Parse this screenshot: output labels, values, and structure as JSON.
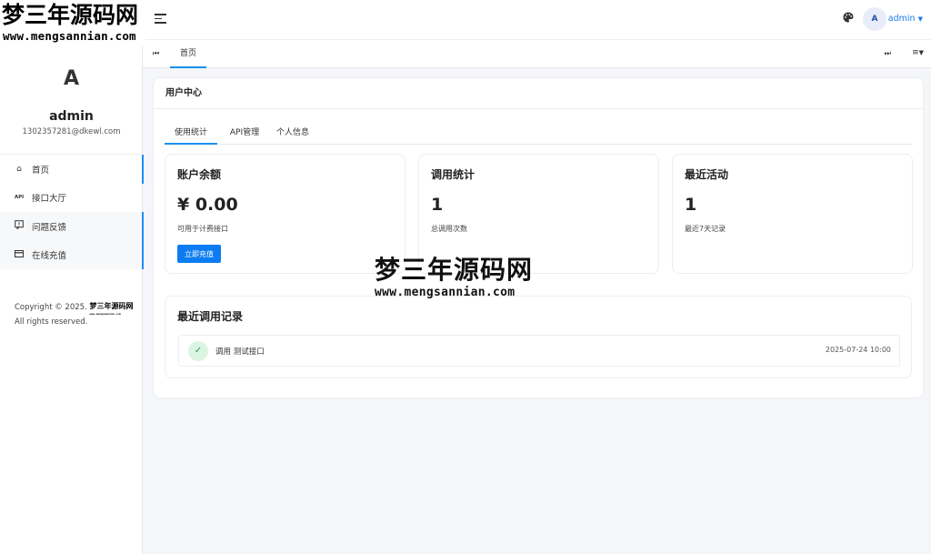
{
  "brand": {
    "name_cn": "梦三年源码网",
    "url": "www.mengsannian.com"
  },
  "profile": {
    "avatar_letter": "A",
    "name": "admin",
    "email": "1302357281@dkewl.com"
  },
  "nav": {
    "items": [
      {
        "icon": "home-icon",
        "glyph": "⌂",
        "label": "首页"
      },
      {
        "icon": "api-icon",
        "glyph": "API",
        "label": "接口大厅"
      },
      {
        "icon": "feedback-icon",
        "glyph": "☐",
        "label": "问题反馈"
      },
      {
        "icon": "card-icon",
        "glyph": "▭",
        "label": "在线充值"
      }
    ]
  },
  "footer": {
    "copyright": "Copyright © 2025.",
    "mini_brand": "梦三年源码网",
    "mini_url": "www.mengsannian.com",
    "rights": "All rights reserved."
  },
  "topbar": {
    "palette_icon": "palette-icon",
    "avatar_letter": "A",
    "user": "admin"
  },
  "tabsbar": {
    "home_tab": "首页"
  },
  "card": {
    "title": "用户中心",
    "subtabs": [
      "使用统计",
      "API管理",
      "个人信息"
    ],
    "stats": [
      {
        "title": "账户余额",
        "value": "¥ 0.00",
        "sub": "可用于计费接口",
        "button": "立即充值"
      },
      {
        "title": "调用统计",
        "value": "1",
        "sub": "总调用次数"
      },
      {
        "title": "最近活动",
        "value": "1",
        "sub": "最近7天记录"
      }
    ],
    "recent": {
      "title": "最近调用记录",
      "rows": [
        {
          "text": "调用 测试接口",
          "time": "2025-07-24 10:00"
        }
      ]
    }
  },
  "watermark": {
    "name_cn": "梦三年源码网",
    "url": "www.mengsannian.com"
  },
  "colors": {
    "accent": "#1a8ff0",
    "button": "#0d7cf2",
    "success": "#2c9a4a"
  }
}
